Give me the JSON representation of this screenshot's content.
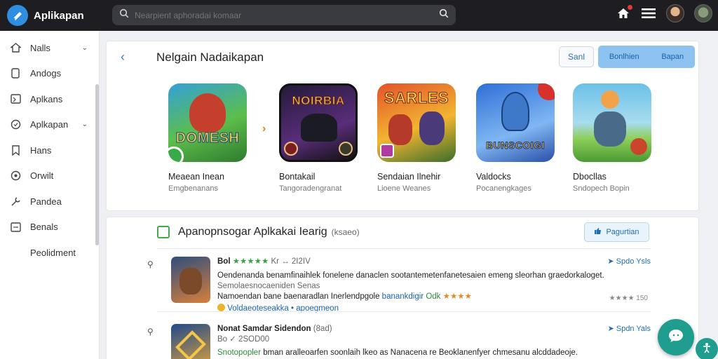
{
  "app": {
    "title": "Aplikapan"
  },
  "search": {
    "placeholder": "Nearpient aphoradai komaar"
  },
  "topbar": {
    "icons": [
      "home-icon",
      "menu-icon",
      "avatar",
      "avatar-secondary"
    ]
  },
  "sidebar": {
    "items": [
      {
        "label": "Nalls",
        "icon": "home-icon",
        "chevron": true
      },
      {
        "label": "Andogs",
        "icon": "phone-icon",
        "chevron": false
      },
      {
        "label": "Aplkans",
        "icon": "grid-icon",
        "chevron": false
      },
      {
        "label": "Aplkapan",
        "icon": "shield-icon",
        "chevron": true
      },
      {
        "label": "Hans",
        "icon": "bookmark-icon",
        "chevron": false
      },
      {
        "label": "Orwilt",
        "icon": "circle-icon",
        "chevron": false
      },
      {
        "label": "Pandea",
        "icon": "wrench-icon",
        "chevron": false
      },
      {
        "label": "Benals",
        "icon": "list-icon",
        "chevron": false
      },
      {
        "label": "Peolidment",
        "icon": "",
        "chevron": false
      }
    ]
  },
  "featured": {
    "title": "Nelgain Nadaikapan",
    "save_label": "Sanl",
    "primary_label": "Bonlhien",
    "primary_extra": "Bapan",
    "apps": [
      {
        "art": "DOMESH",
        "name": "Meaean Inean",
        "sub": "Emgbenanans",
        "colors": [
          "#34a1d8",
          "#5cbe4a",
          "#c4402c"
        ]
      },
      {
        "art": "NOIRBIA",
        "name": "Bontakail",
        "sub": "Tangoradengranat",
        "colors": [
          "#231b3a",
          "#5a2d7a",
          "#111"
        ]
      },
      {
        "art": "SARLES",
        "name": "Sendaian Ilnehir",
        "sub": "Lioene Weanes",
        "colors": [
          "#e2522a",
          "#f2b531",
          "#3a6e2a"
        ]
      },
      {
        "art": "BUNSCOIGI",
        "name": "Valdocks",
        "sub": "Pocanengkages",
        "colors": [
          "#2e6fd8",
          "#7fb6f2",
          "#e9c53a"
        ]
      },
      {
        "art": "",
        "name": "Dbocllas",
        "sub": "Sndopech Bopin",
        "colors": [
          "#6cc0e8",
          "#8fcf5a",
          "#c9452c"
        ]
      }
    ]
  },
  "list": {
    "title": "Apanopnsogar Aplkakai Iearig",
    "count": "(ksaeo)",
    "share_label": "Pagurtian",
    "items": [
      {
        "art_colors": [
          "#2f4e7e",
          "#d8803a"
        ],
        "title": "Bol",
        "stars": "★★★★★",
        "meta": "Kr ↔ 2I2IV",
        "action": "Spdo Ysls",
        "line1": "Oendenanda benamfinaihlek fonelene danaclen sootantemetenfanetesaien emeng sleorhan graedorkaloget.",
        "line2": "Semolaesnocaeniden Senas",
        "line3a": "Namoendan bane baenaradlan Inerlendpgole",
        "line3b": "banankdigir",
        "line3c": "Odk",
        "line3stars": "★★★★",
        "line4": "Voldaeoteseakka • apoegmeon",
        "rating": "★★★★ 150"
      },
      {
        "art_colors": [
          "#214a8a",
          "#e2a43a"
        ],
        "title": "Nonat Samdar Sidendon",
        "meta": "(8ad)",
        "sub": "Bo  ✓ 2SOD00",
        "action": "Spdn Yals",
        "line1a": "Snotopopler",
        "line1b": "bman aralleoarfen soonlaih lkeo as Nanacena re Beoklanenfyer chmesanu alcddadeoje."
      }
    ]
  },
  "fab": {
    "icon": "chat-icon",
    "small_icon": "accessibility-icon"
  }
}
